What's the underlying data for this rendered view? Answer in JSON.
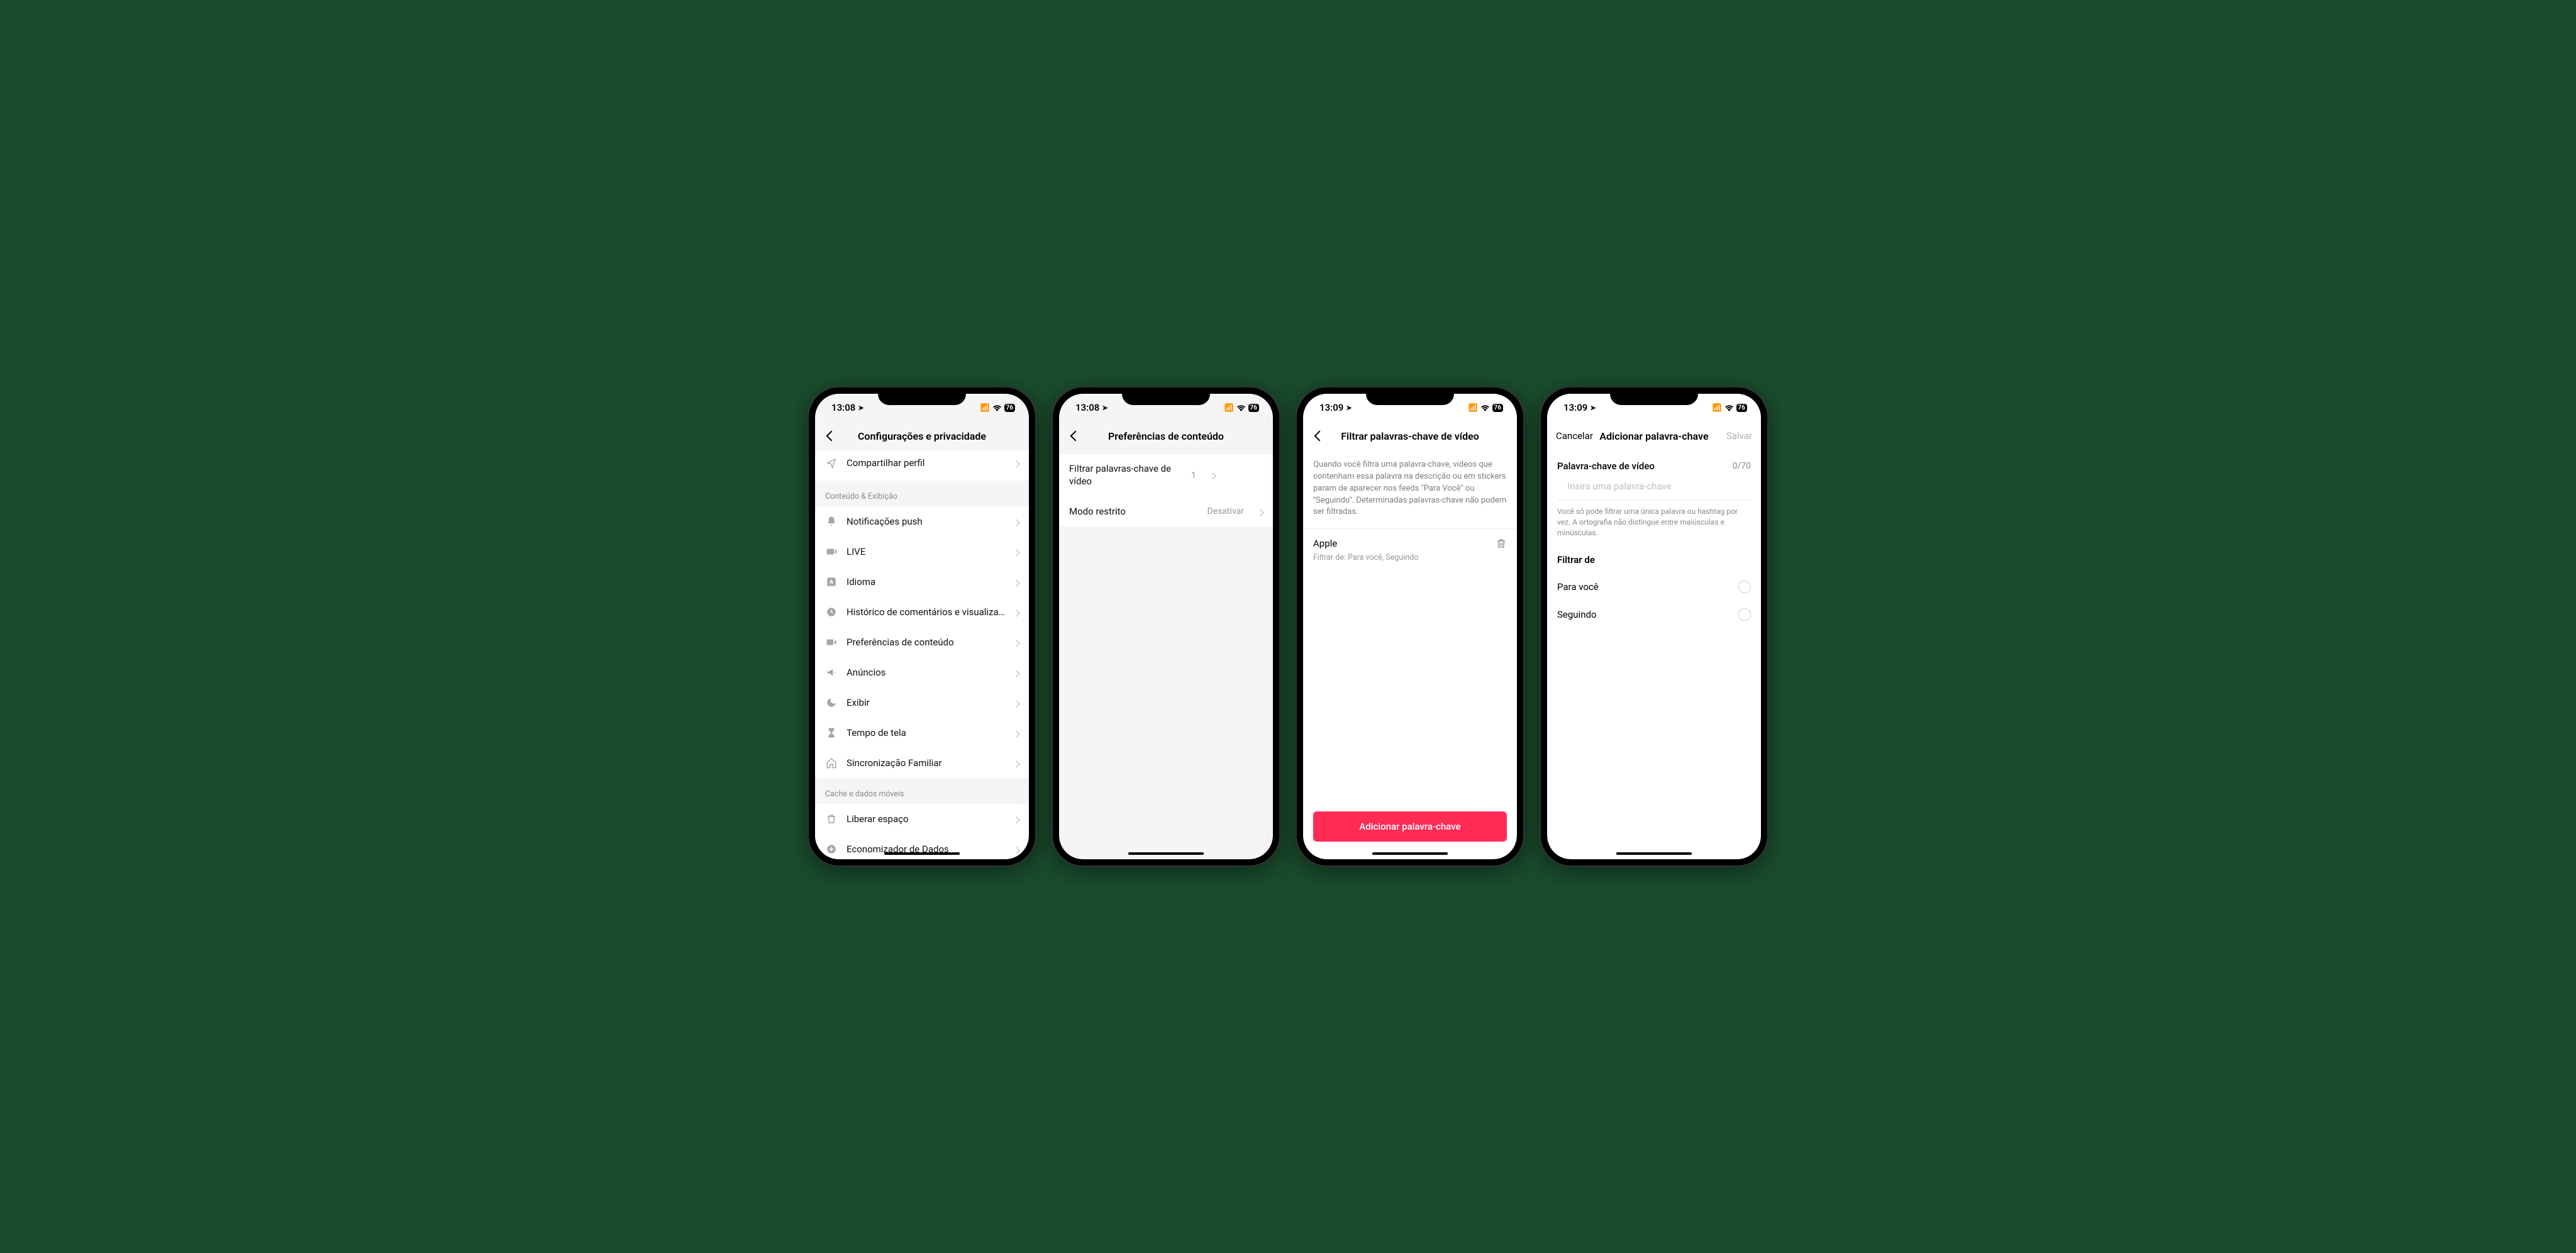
{
  "status": {
    "time1": "13:08",
    "time2": "13:09",
    "battery": "76"
  },
  "phone1": {
    "title": "Configurações e privacidade",
    "partial": "Compartilhar perfil",
    "section1": "Conteúdo & Exibição",
    "items1": [
      "Notificações push",
      "LIVE",
      "Idioma",
      "Histórico de comentários e visualiza...",
      "Preferências de conteúdo",
      "Anúncios",
      "Exibir",
      "Tempo de tela",
      "Sincronização Familiar"
    ],
    "section2": "Cache e dados móveis",
    "items2": [
      "Liberar espaço",
      "Economizador de Dados"
    ]
  },
  "phone2": {
    "title": "Preferências de conteúdo",
    "row1": {
      "label": "Filtrar palavras-chave de vídeo",
      "value": "1"
    },
    "row2": {
      "label": "Modo restrito",
      "value": "Desativar"
    }
  },
  "phone3": {
    "title": "Filtrar palavras-chave de vídeo",
    "desc": "Quando você filtra uma palavra-chave, vídeos que contenham essa palavra na descrição ou em stickers param de aparecer nos feeds \"Para Você\" ou \"Seguindo\". Determinadas palavras-chave não podem ser filtradas.",
    "keyword": "Apple",
    "keyword_sub": "Filtrar de: Para você, Seguindo",
    "button": "Adicionar palavra-chave"
  },
  "phone4": {
    "cancel": "Cancelar",
    "title": "Adicionar palavra-chave",
    "save": "Salvar",
    "field_label": "Palavra-chave de vídeo",
    "field_count": "0/70",
    "placeholder": "Insira uma palavra-chave",
    "hint": "Você só pode filtrar uma única palavra ou hashtag por vez. A ortografia não distingue entre maiúsculas e minúsculas.",
    "filter_title": "Filtrar de",
    "opt1": "Para você",
    "opt2": "Seguindo"
  }
}
